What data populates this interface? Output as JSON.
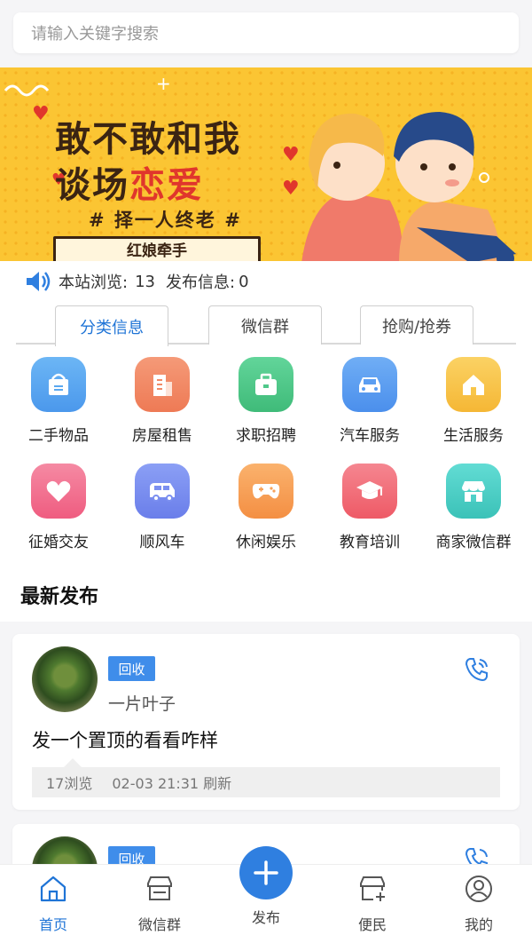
{
  "search": {
    "placeholder": "请输入关键字搜索"
  },
  "banner": {
    "line1": "敢不敢和我",
    "line2_a": "谈场",
    "line2_b": "恋爱",
    "line3": "# 择一人终老 #",
    "plate": "红娘牵手"
  },
  "stats": {
    "views_label": "本站浏览:",
    "views_value": "13",
    "posts_label": "发布信息:",
    "posts_value": "0"
  },
  "tabs": [
    {
      "label": "分类信息",
      "active": true
    },
    {
      "label": "微信群"
    },
    {
      "label": "抢购/抢券"
    }
  ],
  "categories": [
    {
      "label": "二手物品",
      "icon": "basket-icon",
      "color": "#5aa8f0"
    },
    {
      "label": "房屋租售",
      "icon": "building-icon",
      "color": "#f28a66"
    },
    {
      "label": "求职招聘",
      "icon": "briefcase-icon",
      "color": "#4fc88a"
    },
    {
      "label": "汽车服务",
      "icon": "car-icon",
      "color": "#5b9ef2"
    },
    {
      "label": "生活服务",
      "icon": "home-icon",
      "color": "#f8c64a"
    },
    {
      "label": "征婚交友",
      "icon": "heart-icon",
      "color": "#f26e8e"
    },
    {
      "label": "顺风车",
      "icon": "van-icon",
      "color": "#7b8ff0"
    },
    {
      "label": "休闲娱乐",
      "icon": "gamepad-icon",
      "color": "#f7a25a"
    },
    {
      "label": "教育培训",
      "icon": "graduation-cap-icon",
      "color": "#f2707a"
    },
    {
      "label": "商家微信群",
      "icon": "shop-icon",
      "color": "#4fd0c8"
    }
  ],
  "latest": {
    "title": "最新发布"
  },
  "posts": [
    {
      "badge": "回收",
      "nickname": "一片叶子",
      "text": "发一个置顶的看看咋样",
      "views": "17浏览",
      "time": "02-03 21:31 刷新"
    },
    {
      "badge": "回收"
    }
  ],
  "nav": [
    {
      "label": "首页",
      "icon": "home-nav-icon",
      "active": true
    },
    {
      "label": "微信群",
      "icon": "store-nav-icon"
    },
    {
      "label": "发布",
      "icon": "plus-icon"
    },
    {
      "label": "便民",
      "icon": "shop-add-nav-icon"
    },
    {
      "label": "我的",
      "icon": "user-nav-icon"
    }
  ],
  "colors": {
    "accent": "#1f74d6",
    "badge": "#3f8dea",
    "banner": "#fbc533"
  }
}
